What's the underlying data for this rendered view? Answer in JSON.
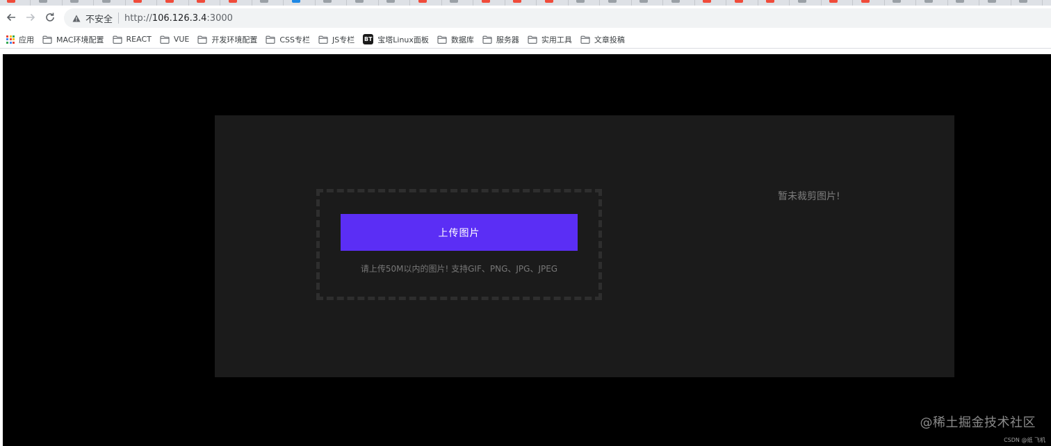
{
  "browser": {
    "security_label": "不安全",
    "url_scheme": "http://",
    "url_host": "106.126.3.4",
    "url_port": ":3000",
    "tab_favicon_colors": [
      "#f04b3a",
      "#9aa0a6",
      "#9aa0a6",
      "#9aa0a6",
      "#f04b3a",
      "#f04b3a",
      "#f04b3a",
      "#f04b3a",
      "#9aa0a6",
      "#1e88e5",
      "#9aa0a6",
      "#9aa0a6",
      "#9aa0a6",
      "#f04b3a",
      "#9aa0a6",
      "#f04b3a",
      "#f04b3a",
      "#f04b3a",
      "#9aa0a6",
      "#9aa0a6",
      "#9aa0a6",
      "#9aa0a6",
      "#f04b3a",
      "#f04b3a",
      "#f04b3a",
      "#9aa0a6",
      "#f04b3a",
      "#f04b3a",
      "#9aa0a6",
      "#9aa0a6",
      "#9aa0a6",
      "#9aa0a6",
      "#9aa0a6",
      "#9aa0a6"
    ]
  },
  "bookmarks": {
    "apps": "应用",
    "items": [
      {
        "label": "MAC环境配置",
        "icon": "folder-icon"
      },
      {
        "label": "REACT",
        "icon": "folder-icon"
      },
      {
        "label": "VUE",
        "icon": "folder-icon"
      },
      {
        "label": "开发环境配置",
        "icon": "folder-icon"
      },
      {
        "label": "CSS专栏",
        "icon": "folder-icon"
      },
      {
        "label": "JS专栏",
        "icon": "folder-icon"
      },
      {
        "label": "宝塔Linux面板",
        "icon": "bt-icon",
        "badge": "BT"
      },
      {
        "label": "数据库",
        "icon": "folder-icon"
      },
      {
        "label": "服务器",
        "icon": "folder-icon"
      },
      {
        "label": "实用工具",
        "icon": "folder-icon"
      },
      {
        "label": "文章投稿",
        "icon": "folder-icon"
      }
    ]
  },
  "uploader": {
    "button_label": "上传图片",
    "hint": "请上传50M以内的图片! 支持GIF、PNG、JPG、JPEG",
    "preview_empty": "暂未裁剪图片!"
  },
  "colors": {
    "accent": "#5b2ef5",
    "page_bg": "#000000",
    "panel_bg": "#1b1b1b"
  },
  "watermark": "@稀土掘金技术社区",
  "credit": "CSDN @纸 飞机"
}
